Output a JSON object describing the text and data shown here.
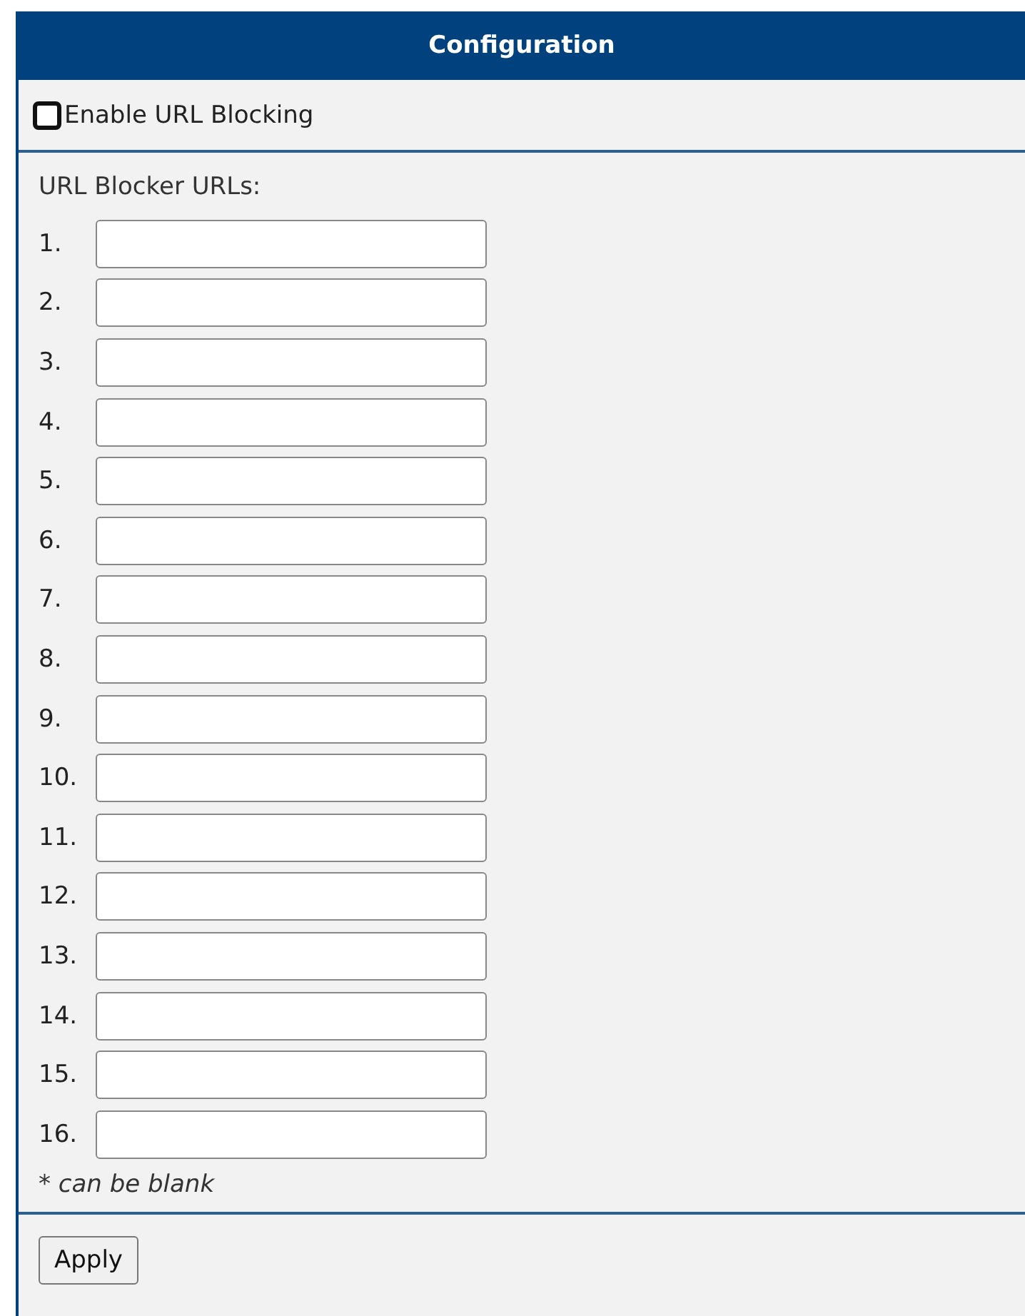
{
  "header": {
    "title": "Configuration"
  },
  "enable": {
    "label": "Enable URL Blocking",
    "checked": false
  },
  "urls": {
    "label": "URL Blocker URLs:",
    "items": [
      {
        "number": "1."
      },
      {
        "number": "2."
      },
      {
        "number": "3."
      },
      {
        "number": "4."
      },
      {
        "number": "5."
      },
      {
        "number": "6."
      },
      {
        "number": "7."
      },
      {
        "number": "8."
      },
      {
        "number": "9."
      },
      {
        "number": "10."
      },
      {
        "number": "11."
      },
      {
        "number": "12."
      },
      {
        "number": "13."
      },
      {
        "number": "14."
      },
      {
        "number": "15."
      },
      {
        "number": "16."
      }
    ]
  },
  "note": "* *can be blank*",
  "buttons": [
    "Apply"
  ]
}
